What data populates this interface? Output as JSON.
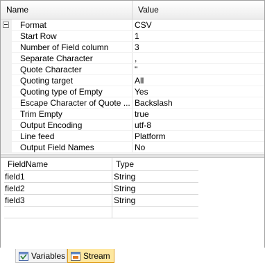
{
  "grid": {
    "header_name": "Name",
    "header_value": "Value",
    "category": {
      "name": "Format",
      "value": "CSV"
    },
    "rows": [
      {
        "name": "Start Row",
        "value": "1"
      },
      {
        "name": "Number of Field column",
        "value": "3"
      },
      {
        "name": "Separate Character",
        "value": ","
      },
      {
        "name": "Quote Character",
        "value": "\""
      },
      {
        "name": "Quoting target",
        "value": "All"
      },
      {
        "name": "Quoting type of Empty",
        "value": "Yes"
      },
      {
        "name": "Escape Character of Quote ...",
        "value": "Backslash"
      },
      {
        "name": "Trim Empty",
        "value": "true"
      },
      {
        "name": "Output Encoding",
        "value": "utf-8"
      },
      {
        "name": "Line feed",
        "value": "Platform"
      },
      {
        "name": "Output Field Names",
        "value": "No"
      }
    ]
  },
  "fields": {
    "headers": [
      "FieldName",
      "Type"
    ],
    "rows": [
      [
        "field1",
        "String"
      ],
      [
        "field2",
        "String"
      ],
      [
        "field3",
        "String"
      ],
      [
        "",
        ""
      ]
    ]
  },
  "tabs": {
    "variables": "Variables",
    "stream": "Stream"
  },
  "colors": {
    "active_tab": "#fde7a0",
    "active_tab_border": "#e0a020"
  }
}
